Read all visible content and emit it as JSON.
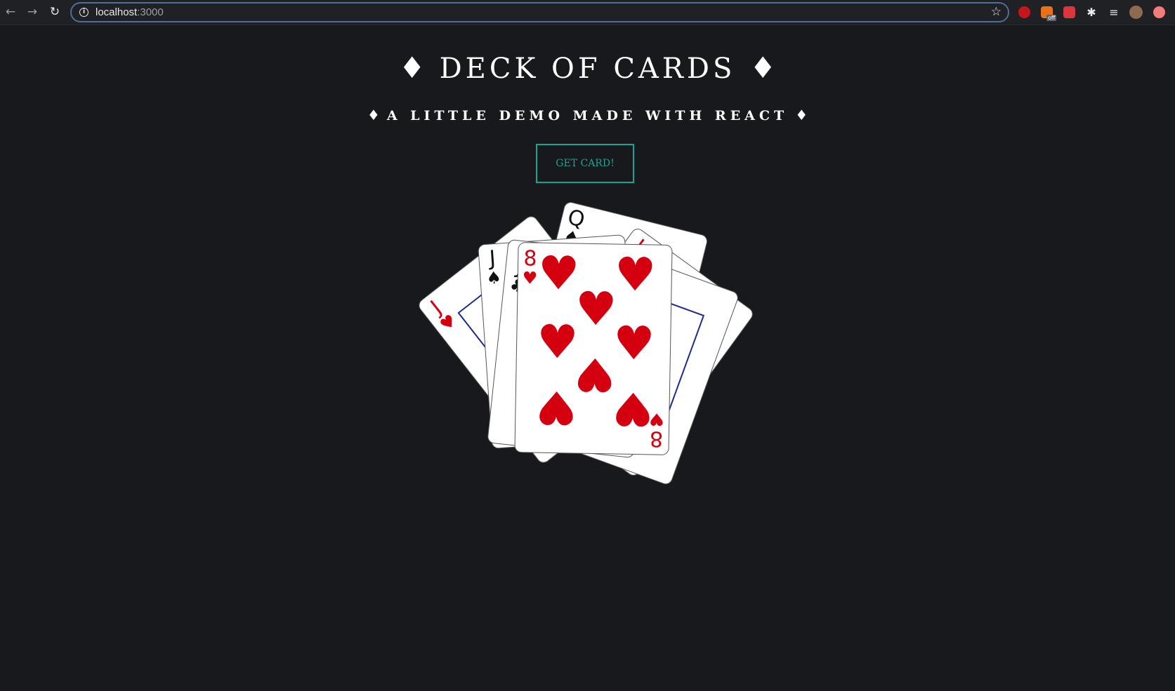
{
  "browser": {
    "url_host": "localhost",
    "url_port": ":3000",
    "extension_badge": "off"
  },
  "page": {
    "title": "DECK OF CARDS",
    "subtitle": "A LITTLE DEMO MADE WITH REACT",
    "title_ornament": "♦",
    "get_card_button": "GET CARD!"
  },
  "cards": [
    {
      "rank": "Q",
      "suit": "♠",
      "color": "#111111"
    },
    {
      "rank": "J",
      "suit": "♥",
      "color": "#d4000f"
    },
    {
      "rank": "J",
      "suit": "♥",
      "color": "#d4000f"
    },
    {
      "rank": "Q",
      "suit": "♠",
      "color": "#111111"
    },
    {
      "rank": "J",
      "suit": "♠",
      "color": "#111111"
    },
    {
      "rank": "J",
      "suit": "♣",
      "color": "#111111"
    },
    {
      "rank": "8",
      "suit": "♥",
      "color": "#d4000f"
    }
  ],
  "colors": {
    "background": "#18191d",
    "accent": "#1aa394",
    "card_red": "#d4000f"
  }
}
